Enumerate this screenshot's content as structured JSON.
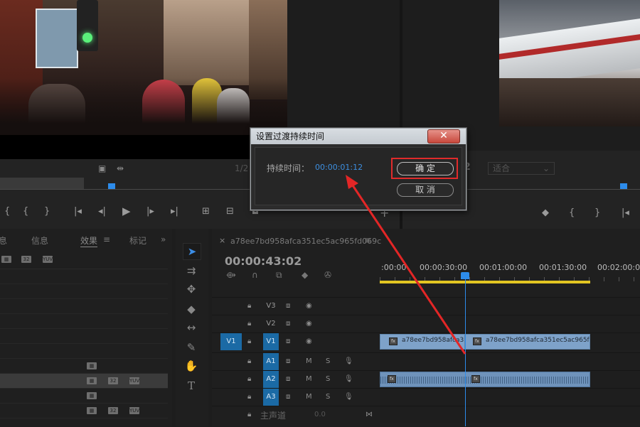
{
  "dialog": {
    "title": "设置过渡持续时间",
    "close_symbol": "✕",
    "duration_label": "持续时间：",
    "duration_value": "00:00:01:12",
    "ok_label": "确 定",
    "cancel_label": "取 消"
  },
  "source_monitor": {
    "zoom_fraction": "1/2"
  },
  "program_monitor": {
    "zoom_fraction": "2",
    "fit_label": "适合"
  },
  "left_panel": {
    "tabs": [
      "息",
      "信息",
      "效果",
      "标记"
    ],
    "active_tab": "效果",
    "badge_labels": [
      "32",
      "YUV"
    ]
  },
  "timeline": {
    "sequence_name": "a78ee7bd958afca351ec5ac965fd069c",
    "timecode": "00:00:43:02",
    "ruler_labels": [
      ":00:00",
      "00:00:30:00",
      "00:01:00:00",
      "00:01:30:00",
      "00:02:00:00"
    ],
    "tracks": [
      {
        "name": "V3"
      },
      {
        "name": "V2"
      },
      {
        "name": "V1",
        "source": "V1"
      },
      {
        "name": "A1",
        "mute": "M",
        "solo": "S"
      },
      {
        "name": "A2",
        "mute": "M",
        "solo": "S"
      },
      {
        "name": "A3",
        "mute": "M",
        "solo": "S"
      }
    ],
    "master_label": "主声道",
    "master_value": "0.0",
    "clip_names": [
      "a78ee7bd958afca351e",
      "a78ee7bd958afca351ec5ac965fd069c"
    ],
    "fx_label": "fx"
  },
  "colors": {
    "accent": "#2d8ceb",
    "highlight": "#e02b2b",
    "workarea": "#e2c522",
    "track_target": "#1b6aa5"
  }
}
